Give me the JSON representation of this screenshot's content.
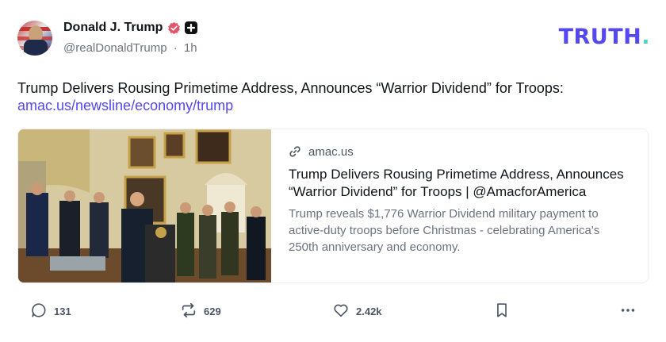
{
  "author": {
    "display_name": "Donald J. Trump",
    "handle": "@realDonaldTrump",
    "time": "1h",
    "separator": "·"
  },
  "brand": {
    "logo_text": "TRUTH",
    "logo_dot": "."
  },
  "post": {
    "text": "Trump Delivers Rousing Primetime Address, Announces “Warrior Dividend” for Troops:",
    "link": "amac.us/newsline/economy/trump"
  },
  "card": {
    "domain": "amac.us",
    "title": "Trump Delivers Rousing Primetime Address, Announces “Warrior Dividend” for Troops | @AmacforAmerica",
    "description": "Trump reveals $1,776 Warrior Dividend military payment to active-duty troops before Christmas - celebrating America's 250th anniversary and economy."
  },
  "actions": {
    "replies": "131",
    "retruths": "629",
    "likes": "2.42k"
  },
  "icons": {
    "verified": "verified-badge-icon",
    "plus": "plus-badge-icon",
    "link": "link-chain-icon",
    "reply": "comment-icon",
    "retruth": "repost-icon",
    "like": "heart-icon",
    "bookmark": "bookmark-icon",
    "more": "more-dots-icon"
  },
  "colors": {
    "brand": "#5448ee",
    "brand_accent": "#4ad5c8",
    "verified": "#e0566a",
    "link": "#5448ee"
  }
}
